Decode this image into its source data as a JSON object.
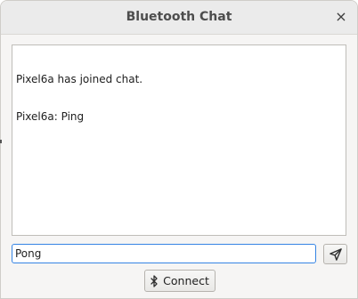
{
  "window": {
    "title": "Bluetooth Chat",
    "close_glyph": "×"
  },
  "chat": {
    "lines": [
      "Pixel6a has joined chat.",
      "Pixel6a: Ping"
    ]
  },
  "composer": {
    "input_value": "Pong",
    "send_icon": "send-icon"
  },
  "footer": {
    "connect_label": "Connect",
    "connect_icon": "bluetooth-icon"
  },
  "colors": {
    "focus_border": "#3584e4",
    "window_bg": "#f6f5f4"
  }
}
